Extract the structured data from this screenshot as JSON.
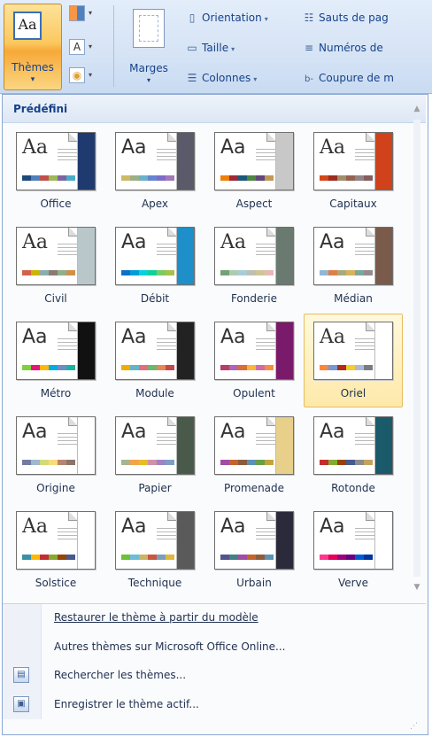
{
  "ribbon": {
    "themes": {
      "label": "Thèmes",
      "icon_text": "Aa",
      "arrow": "▾"
    },
    "small_buttons": [
      {
        "name": "colors-button",
        "glyph": ""
      },
      {
        "name": "fonts-button",
        "glyph": "A"
      },
      {
        "name": "effects-button",
        "glyph": "◉"
      }
    ],
    "marges": {
      "label": "Marges",
      "arrow": "▾"
    },
    "orientation": {
      "label": "Orientation",
      "icon": "page-orientation-icon"
    },
    "taille": {
      "label": "Taille",
      "icon": "page-size-icon"
    },
    "colonnes": {
      "label": "Colonnes",
      "icon": "columns-icon"
    },
    "sauts": {
      "label": "Sauts de pag",
      "icon": "page-breaks-icon"
    },
    "numeros": {
      "label": "Numéros de",
      "icon": "line-numbers-icon"
    },
    "coupure": {
      "label": "Coupure de m",
      "icon": "hyphenation-icon"
    }
  },
  "panel": {
    "section_title": "Prédéfini",
    "themes": [
      {
        "name": "Office",
        "sidebar": "#1f3a6e",
        "serif": true,
        "swatches": [
          "#1f497d",
          "#4f81bd",
          "#c0504d",
          "#9bbb59",
          "#8064a2",
          "#4bacc6"
        ]
      },
      {
        "name": "Apex",
        "sidebar": "#5a5a6a",
        "serif": false,
        "swatches": [
          "#ceb966",
          "#9cb084",
          "#6bb1c9",
          "#6585cf",
          "#7e6bc9",
          "#a379bb"
        ]
      },
      {
        "name": "Aspect",
        "sidebar": "#c8c8c8",
        "serif": false,
        "swatches": [
          "#f07f09",
          "#9f2936",
          "#1b587c",
          "#4e8542",
          "#604878",
          "#c19859"
        ]
      },
      {
        "name": "Capitaux",
        "sidebar": "#d0421b",
        "serif": true,
        "swatches": [
          "#d34817",
          "#9b2d1f",
          "#a28e6a",
          "#956251",
          "#918485",
          "#855d5d"
        ]
      },
      {
        "name": "Civil",
        "sidebar": "#b9c7cb",
        "serif": true,
        "swatches": [
          "#d16349",
          "#ccb400",
          "#8cadae",
          "#8c7b70",
          "#8fb08c",
          "#d19049"
        ]
      },
      {
        "name": "Débit",
        "sidebar": "#1e8fc8",
        "serif": false,
        "swatches": [
          "#0f6fc6",
          "#009dd9",
          "#0bd0d9",
          "#10cf9b",
          "#7cca62",
          "#a5c249"
        ]
      },
      {
        "name": "Fonderie",
        "sidebar": "#6a7a70",
        "serif": true,
        "swatches": [
          "#72a376",
          "#b0ccb0",
          "#a8cdd7",
          "#c0beaf",
          "#cec597",
          "#e8b7b7"
        ]
      },
      {
        "name": "Médian",
        "sidebar": "#7a5a4a",
        "serif": false,
        "swatches": [
          "#94b6d2",
          "#dd8047",
          "#a5ab81",
          "#d8b25c",
          "#7ba79d",
          "#968c8c"
        ]
      },
      {
        "name": "Métro",
        "sidebar": "#111111",
        "serif": false,
        "swatches": [
          "#7fd13b",
          "#ea157a",
          "#feb80a",
          "#00addc",
          "#738ac8",
          "#1ab39f"
        ]
      },
      {
        "name": "Module",
        "sidebar": "#222222",
        "serif": false,
        "swatches": [
          "#f0ad00",
          "#60b5cc",
          "#e66c7d",
          "#6bb76d",
          "#e88651",
          "#c64847"
        ]
      },
      {
        "name": "Opulent",
        "sidebar": "#7a1a6a",
        "serif": false,
        "swatches": [
          "#b83d68",
          "#ac66bb",
          "#de6c36",
          "#f9b639",
          "#cf6da4",
          "#fa8d3d"
        ]
      },
      {
        "name": "Oriel",
        "sidebar": "#ffffff",
        "serif": true,
        "swatches": [
          "#fe8637",
          "#7598d9",
          "#b32c16",
          "#f5cd2d",
          "#aebad5",
          "#777c84"
        ]
      },
      {
        "name": "Origine",
        "sidebar": "#ffffff",
        "serif": false,
        "swatches": [
          "#727ca3",
          "#9fb8cd",
          "#d2da7a",
          "#fada7a",
          "#b88472",
          "#8e736a"
        ]
      },
      {
        "name": "Papier",
        "sidebar": "#4a5a4a",
        "serif": false,
        "swatches": [
          "#a5b592",
          "#f3a447",
          "#e7bc29",
          "#d092a7",
          "#9c85c0",
          "#809ec2"
        ]
      },
      {
        "name": "Promenade",
        "sidebar": "#e8d08a",
        "serif": false,
        "swatches": [
          "#a04da3",
          "#c4652d",
          "#8b5d3d",
          "#5c92b5",
          "#6a9e4c",
          "#c3a43b"
        ]
      },
      {
        "name": "Rotonde",
        "sidebar": "#1a5a6a",
        "serif": false,
        "swatches": [
          "#c32d2e",
          "#84aa33",
          "#964305",
          "#475a8d",
          "#8c8c8c",
          "#c5a25d"
        ]
      },
      {
        "name": "Solstice",
        "sidebar": "#ffffff",
        "serif": true,
        "swatches": [
          "#3891a7",
          "#feb80a",
          "#c32d2e",
          "#84aa33",
          "#964305",
          "#475a8d"
        ]
      },
      {
        "name": "Technique",
        "sidebar": "#5a5a5a",
        "serif": false,
        "swatches": [
          "#6ec038",
          "#6dbdd6",
          "#cbb462",
          "#c9573f",
          "#7c9ebd",
          "#e0b73d"
        ]
      },
      {
        "name": "Urbain",
        "sidebar": "#2a2a3a",
        "serif": false,
        "swatches": [
          "#53548a",
          "#438086",
          "#a04da3",
          "#c4652d",
          "#8b5d3d",
          "#5c92b5"
        ]
      },
      {
        "name": "Verve",
        "sidebar": "#ffffff",
        "serif": false,
        "swatches": [
          "#ff388c",
          "#e40059",
          "#9c007f",
          "#68007f",
          "#005bd3",
          "#00349e"
        ]
      }
    ],
    "selected_theme": "Oriel",
    "menu": {
      "restore": "Restaurer le thème à partir du modèle",
      "more_online": "Autres thèmes sur Microsoft Office Online...",
      "browse": "Rechercher les thèmes...",
      "save": "Enregistrer le thème actif..."
    },
    "scroll": {
      "up": "▲",
      "down": "▼"
    },
    "grip": "⋰"
  },
  "colors": {
    "ribbon_bg": "#d5e3f5",
    "accent_text": "#15428b",
    "selected_bg": "#fde9a9",
    "selected_border": "#e7bd5d"
  }
}
